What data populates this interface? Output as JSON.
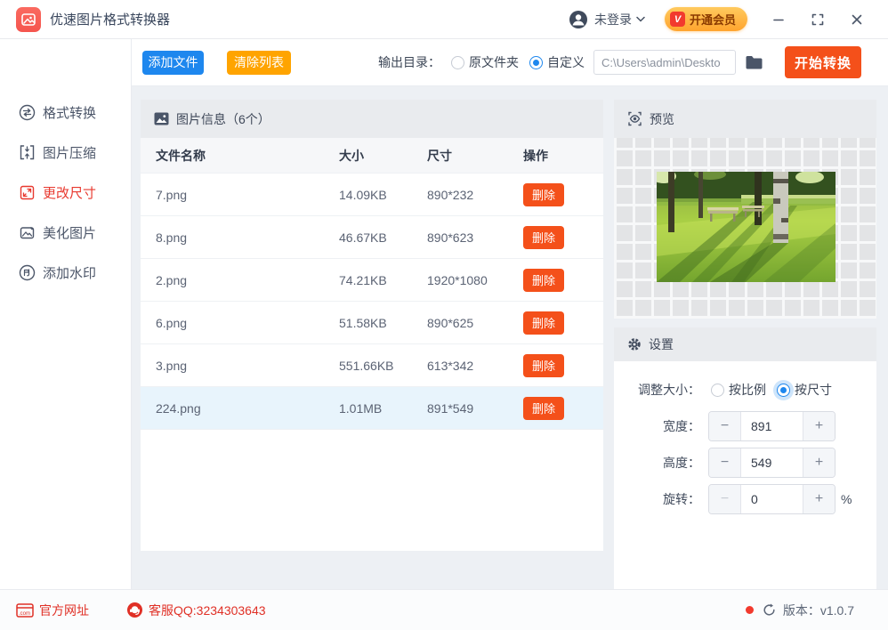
{
  "titlebar": {
    "app_title": "优速图片格式转换器",
    "login_label": "未登录",
    "vip_label": "开通会员",
    "vip_badge": "V"
  },
  "toolbar": {
    "add_files": "添加文件",
    "clear_list": "清除列表",
    "output_dir_label": "输出目录：",
    "radio_original": "原文件夹",
    "radio_custom": "自定义",
    "output_path": "C:\\Users\\admin\\Deskto",
    "start_convert": "开始转换"
  },
  "sidebar": {
    "items": [
      {
        "label": "格式转换",
        "active": false
      },
      {
        "label": "图片压缩",
        "active": false
      },
      {
        "label": "更改尺寸",
        "active": true
      },
      {
        "label": "美化图片",
        "active": false
      },
      {
        "label": "添加水印",
        "active": false
      }
    ]
  },
  "table": {
    "section_title": "图片信息（6个）",
    "columns": [
      "文件名称",
      "大小",
      "尺寸",
      "操作"
    ],
    "delete_label": "删除",
    "rows": [
      {
        "name": "7.png",
        "size": "14.09KB",
        "dims": "890*232",
        "selected": false
      },
      {
        "name": "8.png",
        "size": "46.67KB",
        "dims": "890*623",
        "selected": false
      },
      {
        "name": "2.png",
        "size": "74.21KB",
        "dims": "1920*1080",
        "selected": false
      },
      {
        "name": "6.png",
        "size": "51.58KB",
        "dims": "890*625",
        "selected": false
      },
      {
        "name": "3.png",
        "size": "551.66KB",
        "dims": "613*342",
        "selected": false
      },
      {
        "name": "224.png",
        "size": "1.01MB",
        "dims": "891*549",
        "selected": true
      }
    ]
  },
  "preview": {
    "title": "预览"
  },
  "settings": {
    "title": "设置",
    "resize_label": "调整大小：",
    "radio_ratio": "按比例",
    "radio_size": "按尺寸",
    "width_label": "宽度：",
    "width_value": "891",
    "height_label": "高度：",
    "height_value": "549",
    "rotate_label": "旋转：",
    "rotate_value": "0",
    "rotate_unit": "%",
    "minus": "−",
    "plus": "+"
  },
  "footer": {
    "website": "官方网址",
    "qq": "客服QQ:3234303643",
    "version": "版本：v1.0.7"
  },
  "colors": {
    "accent_blue": "#1e87ee",
    "accent_orange": "#ffa400",
    "accent_red_orange": "#f4501a",
    "sidebar_active": "#e8392f",
    "vip_gradient_top": "#ffca5e",
    "vip_gradient_bottom": "#ffa42e",
    "selected_row_bg": "#e8f4fc",
    "panel_header_bg": "#e9ebee",
    "content_bg": "#edf0f4",
    "footer_red": "#e03026"
  }
}
